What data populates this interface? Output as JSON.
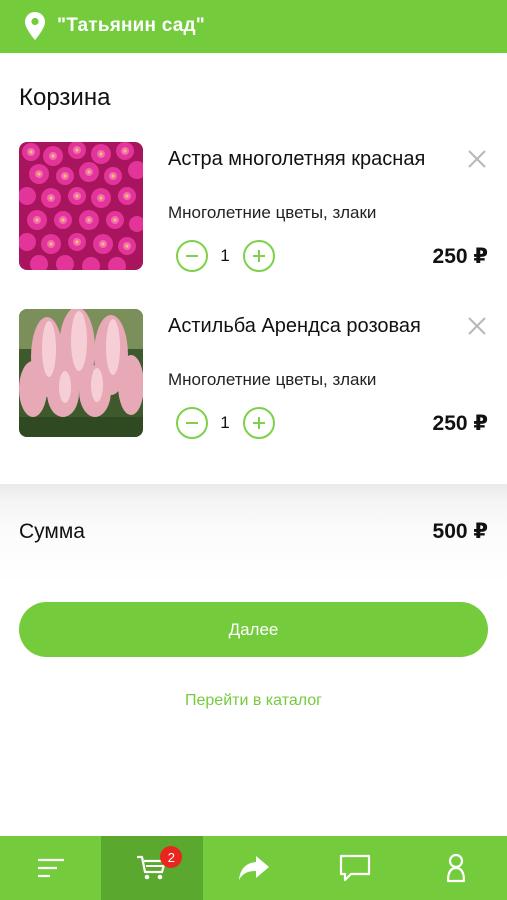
{
  "header": {
    "store_name": "\"Татьянин сад\"",
    "location_icon": "location-pin-icon",
    "color": "#74cc3d"
  },
  "page": {
    "title": "Корзина"
  },
  "cart": {
    "items": [
      {
        "name": "Астра многолетняя красная",
        "category": "Многолетние цветы, злаки",
        "quantity": "1",
        "price": "250 ₽"
      },
      {
        "name": "Астильба Арендса розовая",
        "category": "Многолетние цветы, злаки",
        "quantity": "1",
        "price": "250 ₽"
      }
    ]
  },
  "summary": {
    "label": "Сумма",
    "total": "500 ₽"
  },
  "actions": {
    "next_label": "Далее",
    "catalog_link": "Перейти в каталог"
  },
  "tabbar": {
    "tabs": [
      {
        "icon": "menu-icon",
        "active": false
      },
      {
        "icon": "cart-icon",
        "active": true,
        "badge": "2"
      },
      {
        "icon": "share-icon",
        "active": false
      },
      {
        "icon": "chat-icon",
        "active": false
      },
      {
        "icon": "profile-icon",
        "active": false
      }
    ],
    "active_color": "#5aa82e",
    "badge_color": "#e8261f"
  }
}
